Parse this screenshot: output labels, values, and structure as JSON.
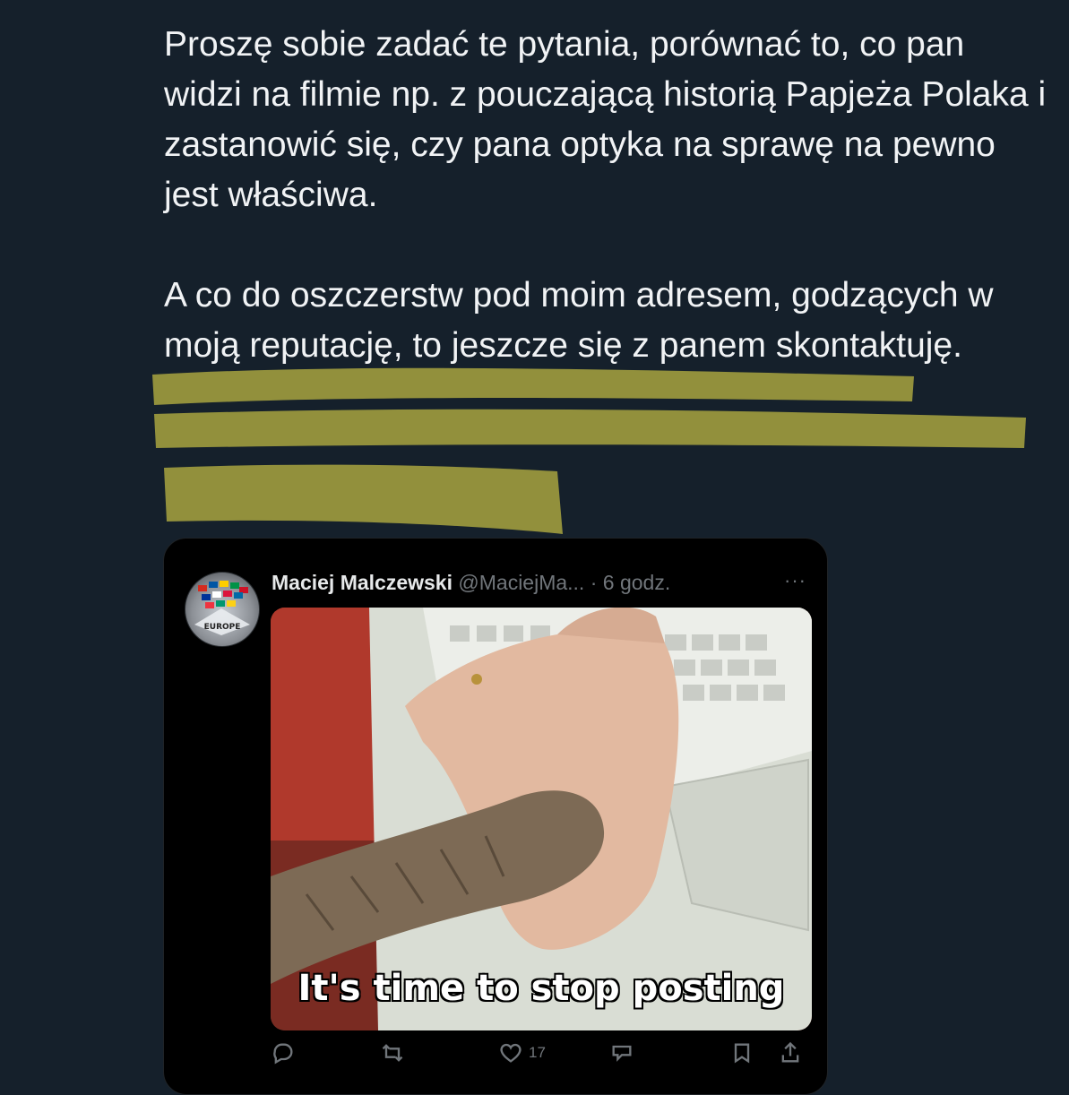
{
  "post": {
    "paragraph1": "Proszę sobie zadać te pytania, porównać to, co pan widzi na filmie np. z pouczającą historią Papjeża Polaka i zastanowić się, czy pana optyka na sprawę na pewno jest właściwa.",
    "paragraph2": "A co do oszczerstw pod moim adresem, godzących w moją reputację, to jeszcze się z panem skontaktuję."
  },
  "quoted_tweet": {
    "author_name": "Maciej Malczewski",
    "handle_time": "@MaciejMa... · 6 godz.",
    "more_label": "···",
    "meme_caption": "It's time to stop posting",
    "avatar_text": "EUROPE",
    "actions": {
      "reply_icon": "reply-icon",
      "retweet_icon": "retweet-icon",
      "like_icon": "heart-icon",
      "like_count": "17",
      "views_icon": "views-icon",
      "bookmark_icon": "bookmark-icon",
      "share_icon": "share-icon"
    }
  },
  "colors": {
    "background": "#15202b",
    "highlight": "#a8a540",
    "text": "#f1f3f5",
    "muted": "#71767b"
  }
}
